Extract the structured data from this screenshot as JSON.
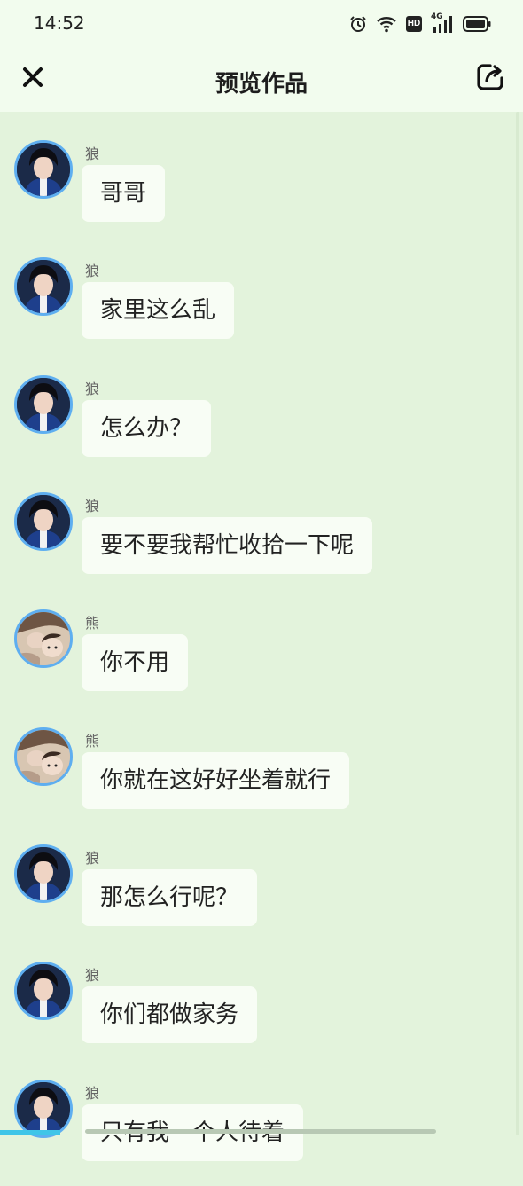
{
  "status_bar": {
    "time": "14:52",
    "icons": [
      "alarm-icon",
      "wifi-icon",
      "hd-icon",
      "cellular-4g-icon",
      "battery-icon"
    ],
    "hd_label": "HD",
    "network_label": "4G"
  },
  "header": {
    "title": "预览作品",
    "close_icon": "close-icon",
    "share_icon": "share-icon"
  },
  "colors": {
    "background": "#e3f3dc",
    "header_background": "#f2fcee",
    "bubble": "#f8fdf5",
    "avatar_border": "#5eaef0",
    "accent": "#3fc5e8"
  },
  "messages": [
    {
      "sender": "狼",
      "text": "哥哥",
      "avatar": "wolf"
    },
    {
      "sender": "狼",
      "text": "家里这么乱",
      "avatar": "wolf"
    },
    {
      "sender": "狼",
      "text": "怎么办？",
      "avatar": "wolf"
    },
    {
      "sender": "狼",
      "text": "要不要我帮忙收拾一下呢",
      "avatar": "wolf"
    },
    {
      "sender": "熊",
      "text": "你不用",
      "avatar": "bear"
    },
    {
      "sender": "熊",
      "text": "你就在这好好坐着就行",
      "avatar": "bear"
    },
    {
      "sender": "狼",
      "text": "那怎么行呢？",
      "avatar": "wolf"
    },
    {
      "sender": "狼",
      "text": "你们都做家务",
      "avatar": "wolf"
    },
    {
      "sender": "狼",
      "text": "只有我一个人待着",
      "avatar": "wolf"
    }
  ]
}
